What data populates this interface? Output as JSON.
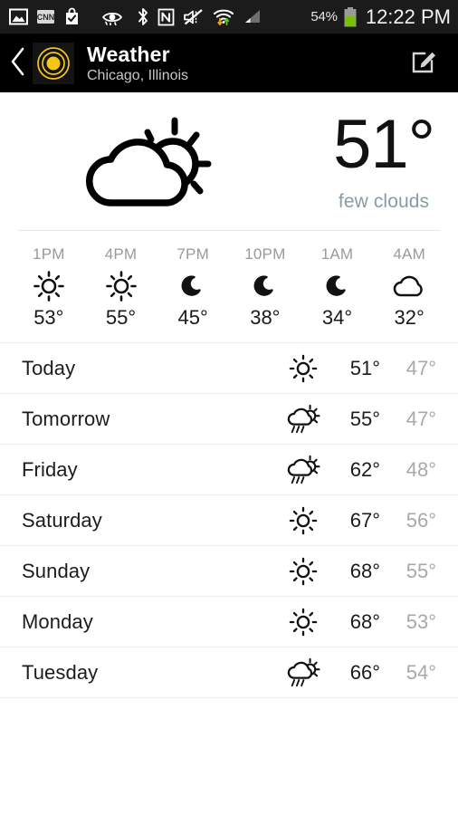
{
  "status_bar": {
    "icons": [
      {
        "name": "gallery-image-icon",
        "label": "image"
      },
      {
        "name": "cnn-app-icon",
        "label": "CNN"
      },
      {
        "name": "play-store-bag-icon",
        "label": "store"
      },
      {
        "name": "smart-stay-eye-icon",
        "label": "smart stay"
      },
      {
        "name": "bluetooth-icon",
        "label": "bluetooth"
      },
      {
        "name": "nfc-icon",
        "label": "NFC"
      },
      {
        "name": "sound-muted-icon",
        "label": "mute"
      },
      {
        "name": "wifi-icon",
        "label": "wifi"
      },
      {
        "name": "cellular-signal-icon",
        "label": "signal"
      }
    ],
    "battery_percent": "54%",
    "clock": "12:22 PM"
  },
  "header": {
    "back_label": "Back",
    "title": "Weather",
    "subtitle": "Chicago, Illinois",
    "edit_label": "Edit",
    "app_icon_color": "#f5c518",
    "background": "#000000"
  },
  "current": {
    "icon": "few-clouds-icon",
    "temperature": "51°",
    "description": "few clouds",
    "description_color": "#8a9ba3"
  },
  "hourly": [
    {
      "time": "1PM",
      "icon": "sun-icon",
      "temp": "53°"
    },
    {
      "time": "4PM",
      "icon": "sun-icon",
      "temp": "55°"
    },
    {
      "time": "7PM",
      "icon": "moon-icon",
      "temp": "45°"
    },
    {
      "time": "10PM",
      "icon": "moon-icon",
      "temp": "38°"
    },
    {
      "time": "1AM",
      "icon": "moon-icon",
      "temp": "34°"
    },
    {
      "time": "4AM",
      "icon": "cloud-icon",
      "temp": "32°"
    }
  ],
  "daily": [
    {
      "day": "Today",
      "icon": "sun-icon",
      "high": "51°",
      "low": "47°"
    },
    {
      "day": "Tomorrow",
      "icon": "sun-showers-icon",
      "high": "55°",
      "low": "47°"
    },
    {
      "day": "Friday",
      "icon": "sun-showers-icon",
      "high": "62°",
      "low": "48°"
    },
    {
      "day": "Saturday",
      "icon": "sun-icon",
      "high": "67°",
      "low": "56°"
    },
    {
      "day": "Sunday",
      "icon": "sun-icon",
      "high": "68°",
      "low": "55°"
    },
    {
      "day": "Monday",
      "icon": "sun-icon",
      "high": "68°",
      "low": "53°"
    },
    {
      "day": "Tuesday",
      "icon": "sun-showers-icon",
      "high": "66°",
      "low": "54°"
    }
  ]
}
